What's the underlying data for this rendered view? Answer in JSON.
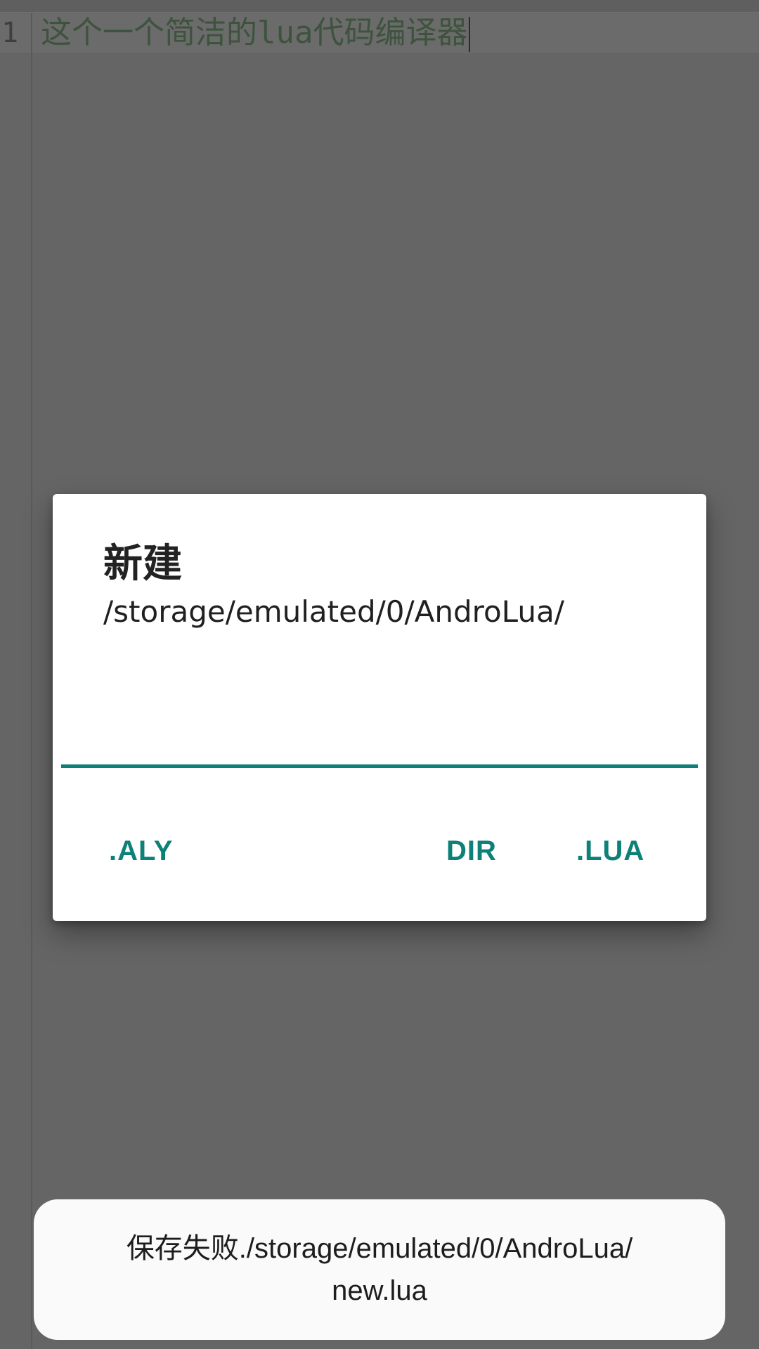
{
  "editor": {
    "line_number": "1",
    "code_text": "这个一个简洁的lua代码编译器"
  },
  "dialog": {
    "title": "新建",
    "path": "/storage/emulated/0/AndroLua/",
    "input_value": "",
    "buttons": {
      "aly_label": ".ALY",
      "dir_label": "DIR",
      "lua_label": ".LUA"
    }
  },
  "toast": {
    "line1": "保存失败./storage/emulated/0/AndroLua/",
    "line2": "new.lua"
  },
  "colors": {
    "accent": "#0d8177",
    "scrim": "#656565",
    "dialog_bg": "#ffffff",
    "toast_bg": "#fafafa"
  }
}
